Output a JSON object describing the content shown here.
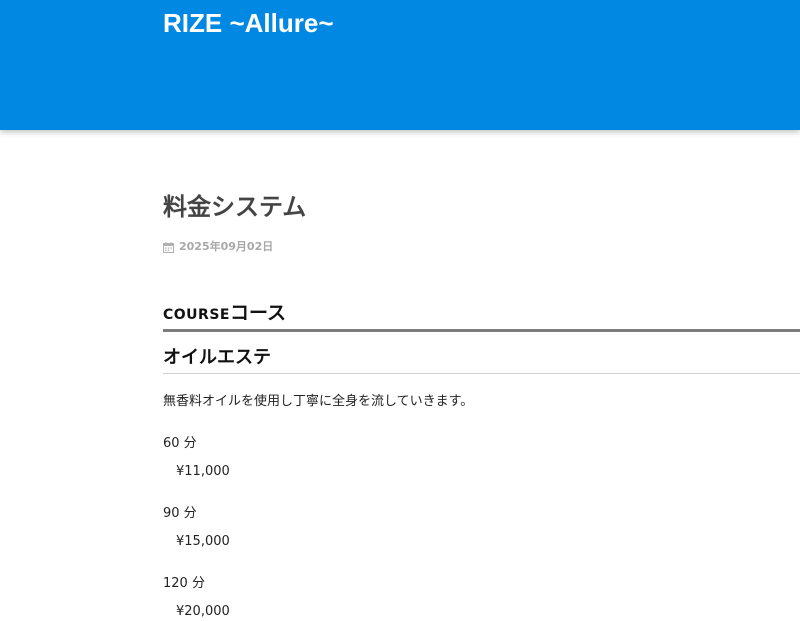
{
  "header": {
    "site_title": "RIZE ~Allure~",
    "background_color": "#0088e3"
  },
  "article": {
    "title": "料金システム",
    "date": "2025年09月02日",
    "date_icon": "calendar-icon",
    "section": {
      "label_en": "COURSE",
      "label_ja": "コース"
    },
    "course": {
      "name": "オイルエステ",
      "description": "無香料オイルを使用し丁寧に全身を流していきます。",
      "prices": [
        {
          "duration": "60 分",
          "price": "¥11,000"
        },
        {
          "duration": "90 分",
          "price": "¥15,000"
        },
        {
          "duration": "120 分",
          "price": "¥20,000"
        }
      ]
    }
  }
}
